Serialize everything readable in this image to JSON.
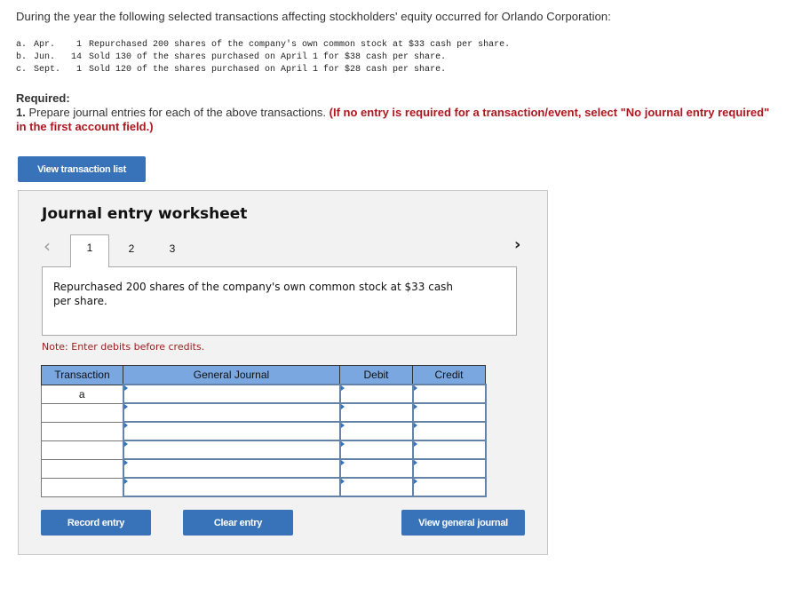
{
  "intro": "During the year the following selected transactions affecting stockholders' equity occurred for Orlando Corporation:",
  "transactions": [
    {
      "letter": "a.",
      "month": "Apr.",
      "day": "1",
      "text": "Repurchased 200 shares of the company's own common stock at $33 cash per share."
    },
    {
      "letter": "b.",
      "month": "Jun.",
      "day": "14",
      "text": "Sold 130 of the shares purchased on April 1 for $38 cash per share."
    },
    {
      "letter": "c.",
      "month": "Sept.",
      "day": "1",
      "text": "Sold 120 of the shares purchased on April 1 for $28 cash per share."
    }
  ],
  "required": {
    "heading": "Required:",
    "number": "1.",
    "instruction": " Prepare journal entries for each of the above transactions. ",
    "note": "(If no entry is required for a transaction/event, select \"No journal entry required\" in the first account field.)"
  },
  "buttons": {
    "view_transaction_list": "View transaction list",
    "record_entry": "Record entry",
    "clear_entry": "Clear entry",
    "view_general_journal": "View general journal"
  },
  "worksheet": {
    "title": "Journal entry worksheet",
    "prev_icon": "chevron-left",
    "next_icon": "chevron-right",
    "tabs": [
      "1",
      "2",
      "3"
    ],
    "active_tab": "1",
    "description": "Repurchased 200 shares of the company's own common stock at $33 cash per share.",
    "note": "Note: Enter debits before credits.",
    "table": {
      "headers": [
        "Transaction",
        "General Journal",
        "Debit",
        "Credit"
      ],
      "rows": [
        {
          "transaction": "a",
          "account": "",
          "debit": "",
          "credit": ""
        },
        {
          "transaction": "",
          "account": "",
          "debit": "",
          "credit": ""
        },
        {
          "transaction": "",
          "account": "",
          "debit": "",
          "credit": ""
        },
        {
          "transaction": "",
          "account": "",
          "debit": "",
          "credit": ""
        },
        {
          "transaction": "",
          "account": "",
          "debit": "",
          "credit": ""
        },
        {
          "transaction": "",
          "account": "",
          "debit": "",
          "credit": ""
        }
      ]
    }
  },
  "colors": {
    "button": "#3872b8",
    "header": "#7aa7e0",
    "required_red": "#b0161e",
    "note_red": "#9c1b1b"
  }
}
